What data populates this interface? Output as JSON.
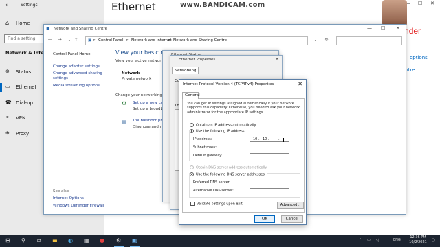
{
  "settings": {
    "title": "Settings",
    "back_icon": "arrow-left-icon",
    "home_label": "Home",
    "search_placeholder": "Find a setting",
    "section": "Network & Internet",
    "nav": [
      {
        "label": "Status",
        "icon": "globe-icon"
      },
      {
        "label": "Ethernet",
        "icon": "ethernet-icon"
      },
      {
        "label": "Dial-up",
        "icon": "phone-icon"
      },
      {
        "label": "VPN",
        "icon": "vpn-icon"
      },
      {
        "label": "Proxy",
        "icon": "globe-icon"
      }
    ],
    "page_title": "Ethernet",
    "right_links": [
      "options",
      "entre"
    ]
  },
  "watermark": "www.BANDICAM.com",
  "overlay_text": "Tech contender",
  "nsc": {
    "title": "Network and Sharing Centre",
    "breadcrumb": [
      "Control Panel",
      ">",
      "Network and Internet",
      ">",
      "Network and Sharing Centre"
    ],
    "sidebar": {
      "home": "Control Panel Home",
      "links": [
        "Change adapter settings",
        "Change advanced sharing settings",
        "Media streaming options"
      ],
      "see_also": "See also",
      "see_also_links": [
        "Internet Options",
        "Windows Defender Firewall"
      ]
    },
    "main_title": "View your basic netw",
    "active_networks": "View your active networks",
    "network_name": "Network",
    "network_type": "Private network",
    "change_settings": "Change your networking se",
    "setup_link": "Set up a new conn",
    "setup_desc": "Set up a broadban",
    "troubleshoot_link": "Troubleshoot pro",
    "troubleshoot_desc": "Diagnose and rep"
  },
  "eth_status": {
    "title": "Ethernet Status"
  },
  "eth_props": {
    "title": "Ethernet Properties",
    "tab": "Networking",
    "frag1": "Co",
    "frag2": "Th"
  },
  "ipv4": {
    "title": "Internet Protocol Version 4 (TCP/IPv4) Properties",
    "tab": "General",
    "info": "You can get IP settings assigned automatically if your network supports this capability. Otherwise, you need to ask your network administrator for the appropriate IP settings.",
    "auto_ip": "Obtain an IP address automatically",
    "use_ip": "Use the following IP address:",
    "ip_label": "IP address:",
    "ip_value": [
      "10",
      "10",
      "",
      ""
    ],
    "subnet_label": "Subnet mask:",
    "gateway_label": "Default gateway:",
    "auto_dns": "Obtain DNS server address automatically",
    "use_dns": "Use the following DNS server addresses:",
    "pref_dns": "Preferred DNS server:",
    "alt_dns": "Alternative DNS server:",
    "validate": "Validate settings upon exit",
    "advanced": "Advanced...",
    "ok": "OK",
    "cancel": "Cancel"
  },
  "taskbar": {
    "lang": "ENG",
    "time": "12:36 PM",
    "date": "10/2/2021"
  }
}
